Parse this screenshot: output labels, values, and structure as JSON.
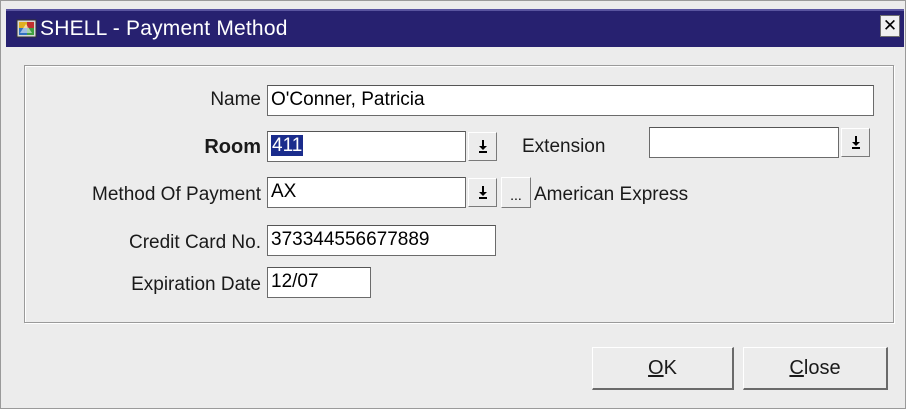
{
  "window": {
    "title": "SHELL - Payment Method",
    "close_glyph": "✕"
  },
  "form": {
    "name": {
      "label": "Name",
      "value": "O'Conner, Patricia"
    },
    "room": {
      "label": "Room",
      "value": "411"
    },
    "extension": {
      "label": "Extension",
      "value": ""
    },
    "method_of_payment": {
      "label": "Method Of Payment",
      "value": "AX",
      "description": "American Express",
      "dots_label": "..."
    },
    "credit_card": {
      "label": "Credit Card No.",
      "value": "373344556677889"
    },
    "expiration": {
      "label": "Expiration Date",
      "value": "12/07"
    }
  },
  "buttons": {
    "ok": {
      "mnemonic": "O",
      "rest": "K"
    },
    "close": {
      "mnemonic": "C",
      "rest": "lose"
    }
  },
  "icons": {
    "app": "app-icon",
    "dropdown": "dropdown-arrow-icon",
    "close": "close-icon"
  },
  "colors": {
    "titlebar": "#272170",
    "selection": "#1a2c8c",
    "background": "#ececec"
  }
}
